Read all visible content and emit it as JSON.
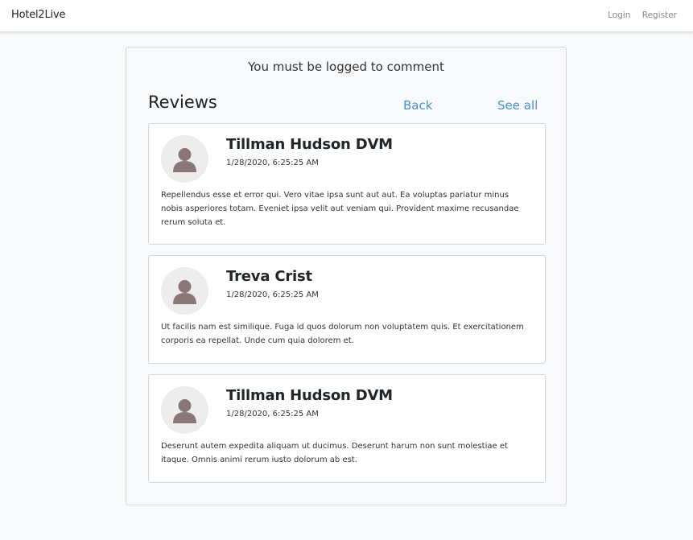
{
  "navbar": {
    "brand": "Hotel2Live",
    "login_label": "Login",
    "register_label": "Register"
  },
  "main": {
    "notice": "You must be logged to comment",
    "reviews_title": "Reviews",
    "back_label": "Back",
    "see_all_label": "See all"
  },
  "reviews": [
    {
      "name": "Tillman Hudson DVM",
      "date": "1/28/2020, 6:25:25 AM",
      "text": "Repellendus esse et error qui. Vero vitae ipsa sunt aut aut. Ea voluptas pariatur minus nobis asperiores totam. Eveniet ipsa velit aut veniam qui. Provident maxime recusandae rerum soluta et."
    },
    {
      "name": "Treva Crist",
      "date": "1/28/2020, 6:25:25 AM",
      "text": "Ut facilis nam est similique. Fuga id quos dolorum non voluptatem quis. Et exercitationem corporis ea repellat. Unde cum quia dolorem et."
    },
    {
      "name": "Tillman Hudson DVM",
      "date": "1/28/2020, 6:25:25 AM",
      "text": "Deserunt autem expedita aliquam ut ducimus. Deserunt harum non sunt molestiae et itaque. Omnis animi rerum iusto dolorum ab est."
    }
  ],
  "colors": {
    "link": "#4a8fd4",
    "avatar_bg": "#ededed",
    "avatar_fg": "#8a7878"
  }
}
